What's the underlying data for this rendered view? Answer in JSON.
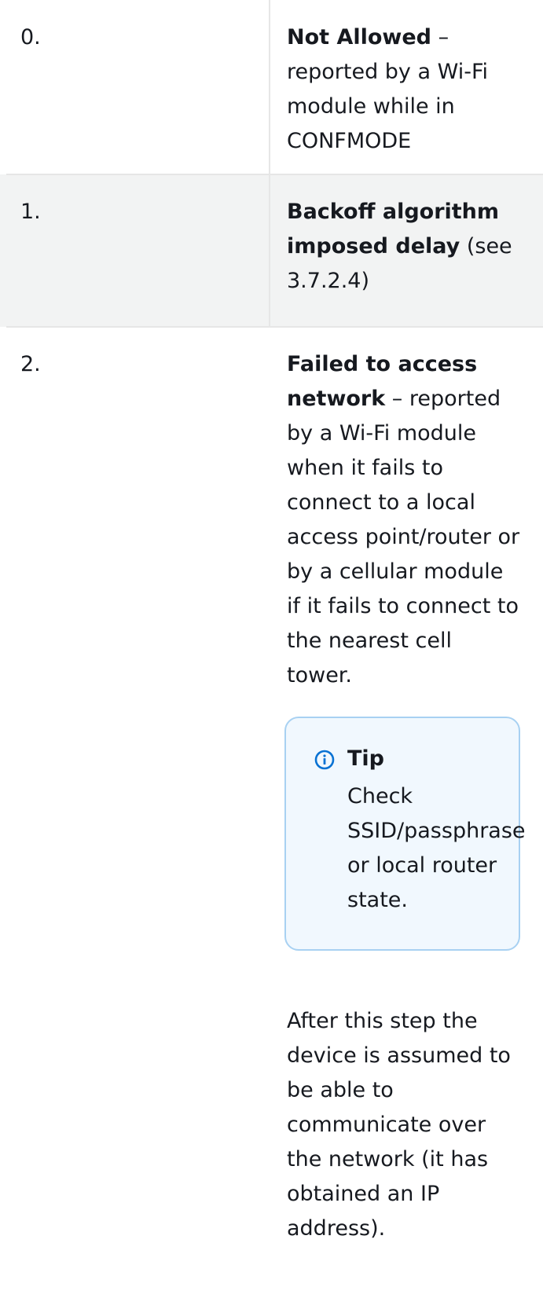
{
  "rows": [
    {
      "code": "0.",
      "title": "Not Allowed",
      "text": " – reported by a Wi-Fi module while in CONFMODE"
    },
    {
      "code": "1.",
      "title": "Backoff algorithm imposed delay",
      "text": " (see 3.7.2.4)"
    },
    {
      "code": "2.",
      "title": "Failed to access network",
      "text": " – reported by a Wi-Fi module when it fails to connect to a local access point/router or by a cellular module if it fails to connect to the nearest cell tower."
    }
  ],
  "tip": {
    "icon": "info-icon",
    "title": "Tip",
    "body": "Check SSID/passphrase or local router state."
  },
  "after_text": "After this step the device is assumed to be able to communicate over the network (it has obtained an IP address).",
  "colors": {
    "text": "#16191f",
    "stripe": "#f2f3f3",
    "divider": "#e6e6e6",
    "tip_border": "#a8d1f2",
    "tip_background": "#f1f8fe",
    "info_icon": "#0972d3"
  }
}
